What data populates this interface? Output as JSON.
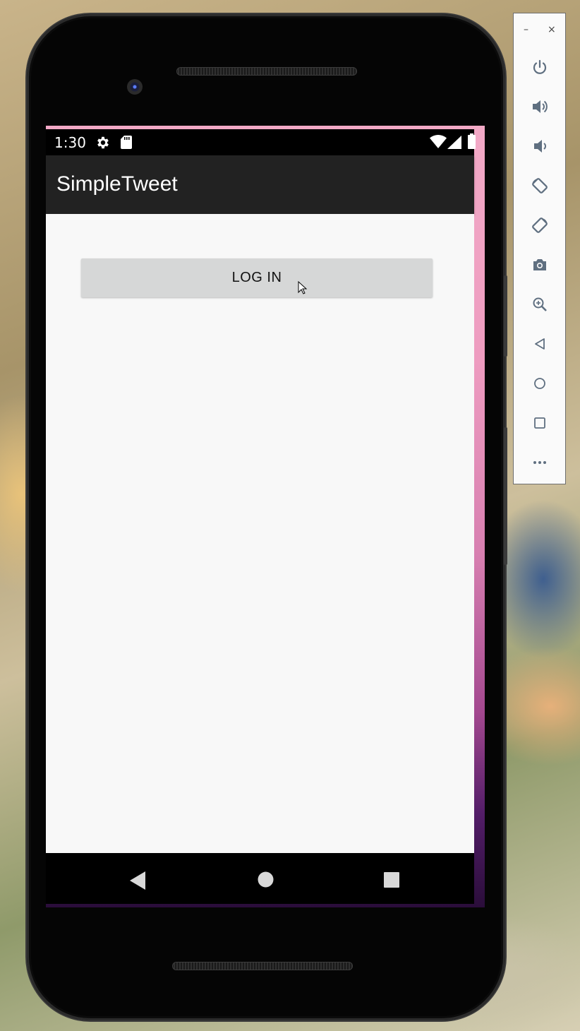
{
  "status_bar": {
    "time": "1:30",
    "icons": [
      "gear-icon",
      "sd-card-icon",
      "wifi-icon",
      "signal-icon",
      "battery-icon"
    ]
  },
  "app_bar": {
    "title": "SimpleTweet"
  },
  "main": {
    "login_button_label": "LOG IN"
  },
  "nav_bar": {
    "buttons": [
      "back-icon",
      "home-icon",
      "recents-icon"
    ]
  },
  "emulator_toolbar": {
    "minimize": "–",
    "close": "×",
    "buttons": [
      "power-icon",
      "volume-up-icon",
      "volume-down-icon",
      "rotate-left-icon",
      "rotate-right-icon",
      "camera-icon",
      "zoom-icon",
      "back-icon",
      "home-icon",
      "overview-icon",
      "more-icon"
    ]
  },
  "colors": {
    "app_bar": "#222222",
    "content_bg": "#f8f8f8",
    "button_bg": "#d6d7d7",
    "toolbar_icon": "#5f6f80"
  }
}
